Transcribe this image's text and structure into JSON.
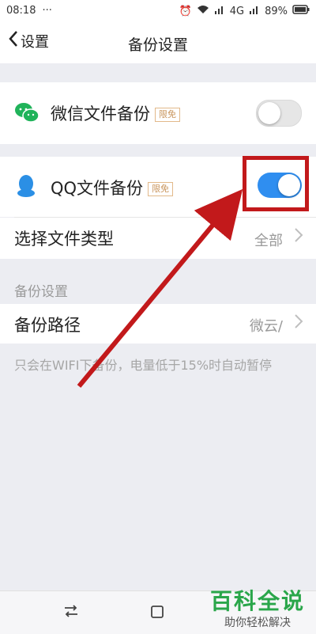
{
  "statusbar": {
    "time": "08:18",
    "dots": "···",
    "signal_text": "4G",
    "battery": "89%"
  },
  "nav": {
    "title": "备份设置",
    "back_label": "设置"
  },
  "wechat": {
    "label": "微信文件备份",
    "badge": "限免",
    "enabled": false
  },
  "qq": {
    "label": "QQ文件备份",
    "badge": "限免",
    "enabled": true
  },
  "filetype": {
    "label": "选择文件类型",
    "value": "全部"
  },
  "section": {
    "title": "备份设置"
  },
  "path": {
    "label": "备份路径",
    "value": "微云/"
  },
  "note": "只会在WIFI下备份，电量低于15%时自动暂停",
  "watermark": {
    "big": "百科全说",
    "small": "助你轻松解决"
  },
  "colors": {
    "toggle_on": "#2f8ef0",
    "toggle_off": "#e6e6e6",
    "wechat_green": "#20b35a",
    "qq_blue": "#2b8fe5",
    "annotation_red": "#c2191b"
  }
}
